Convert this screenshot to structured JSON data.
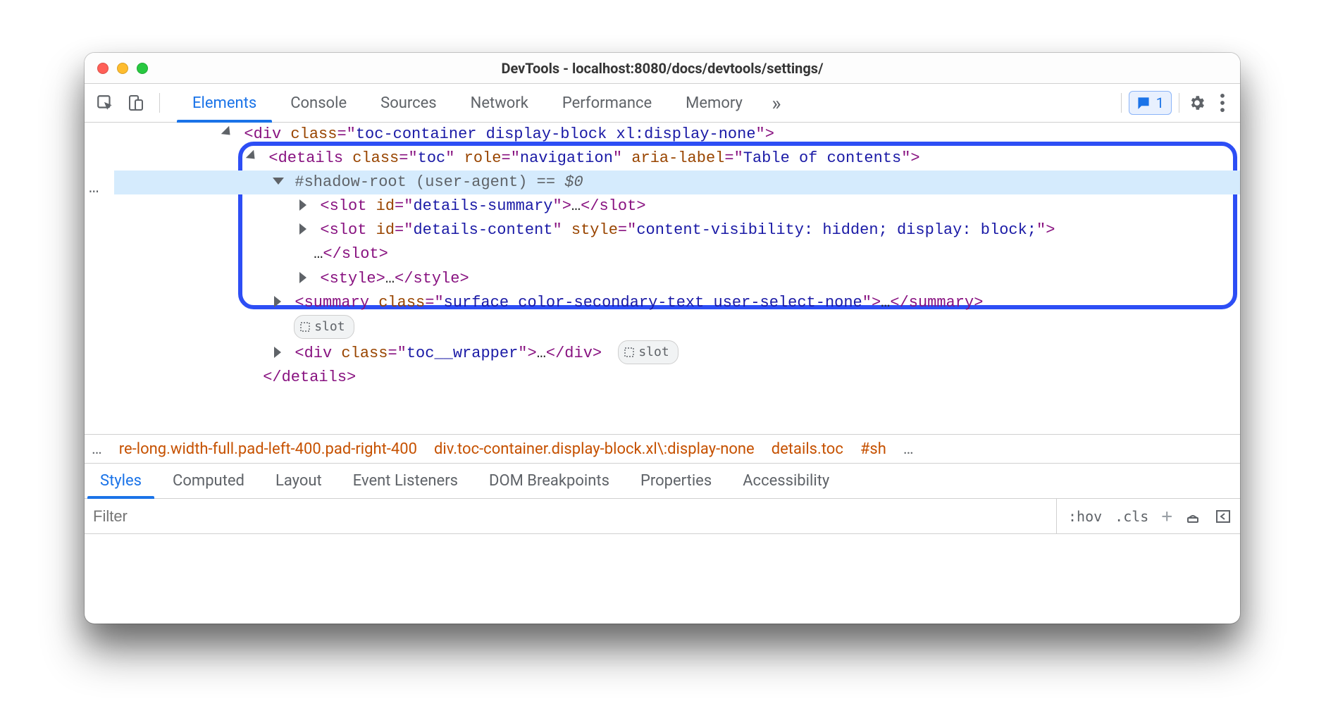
{
  "window": {
    "title": "DevTools - localhost:8080/docs/devtools/settings/",
    "issues_count": "1"
  },
  "main_tabs": [
    "Elements",
    "Console",
    "Sources",
    "Network",
    "Performance",
    "Memory"
  ],
  "gutter_more": "…",
  "dom": {
    "l1_tag": "div",
    "l1_attr_class_n": "class",
    "l1_attr_class_v": "toc-container display-block xl:display-none",
    "l2_tag": "details",
    "l2_class_v": "toc",
    "l2_role_n": "role",
    "l2_role_v": "navigation",
    "l2_aria_n": "aria-label",
    "l2_aria_v": "Table of contents",
    "shadow_label": "#shadow-root (user-agent)",
    "eqeq": " == ",
    "dollar": "$0",
    "slot_tag": "slot",
    "slot1_id_v": "details-summary",
    "slot2_id_v": "details-content",
    "slot2_style_v": "content-visibility: hidden; display: block;",
    "ellip": "…",
    "style_tag": "style",
    "summary_tag": "summary",
    "summary_class_v": "surface color-secondary-text user-select-none",
    "div_tag": "div",
    "div_class_v": "toc__wrapper",
    "details_close": "details",
    "id_attr": "id",
    "class_attr": "class",
    "style_attr": "style",
    "slot_badge": "slot"
  },
  "crumbs": {
    "lead": "…",
    "c1": "re-long.width-full.pad-left-400.pad-right-400",
    "c2": "div.toc-container.display-block.xl\\:display-none",
    "c3": "details.toc",
    "c4": "#sh",
    "trail": "…"
  },
  "sub_tabs": [
    "Styles",
    "Computed",
    "Layout",
    "Event Listeners",
    "DOM Breakpoints",
    "Properties",
    "Accessibility"
  ],
  "filter": {
    "placeholder": "Filter",
    "hov": ":hov",
    "cls": ".cls"
  }
}
